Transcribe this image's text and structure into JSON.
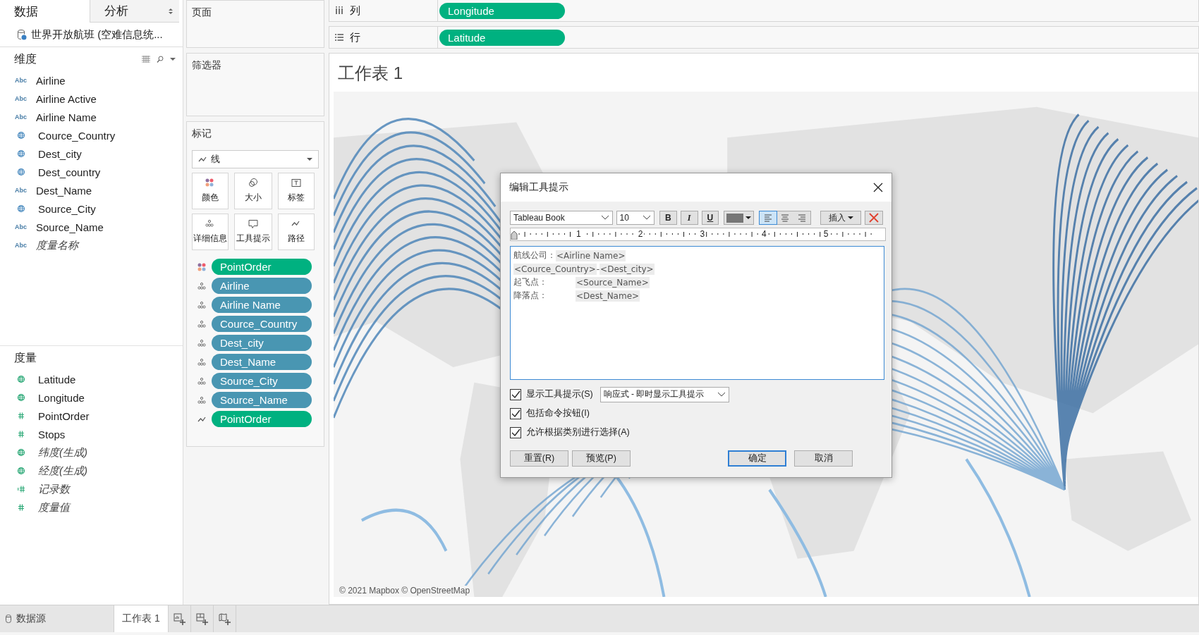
{
  "sidebar": {
    "tabs": [
      {
        "label": "数据",
        "selected": true
      },
      {
        "label": "分析",
        "selected": false
      }
    ],
    "datasource": "世界开放航班 (空难信息统...",
    "dimensions": {
      "title": "维度",
      "fields": [
        {
          "name": "Airline",
          "kind": "string",
          "badge": "Abc",
          "generated": false
        },
        {
          "name": "Airline Active",
          "kind": "string",
          "badge": "Abc",
          "generated": false
        },
        {
          "name": "Airline Name",
          "kind": "string",
          "badge": "Abc",
          "generated": false
        },
        {
          "name": "Cource_Country",
          "kind": "geo",
          "generated": false
        },
        {
          "name": "Dest_city",
          "kind": "geo",
          "generated": false
        },
        {
          "name": "Dest_country",
          "kind": "geo",
          "generated": false
        },
        {
          "name": "Dest_Name",
          "kind": "string",
          "badge": "Abc",
          "generated": false
        },
        {
          "name": "Source_City",
          "kind": "geo",
          "generated": false
        },
        {
          "name": "Source_Name",
          "kind": "string",
          "badge": "Abc",
          "generated": false
        },
        {
          "name": "度量名称",
          "kind": "string",
          "badge": "Abc",
          "generated": true
        }
      ]
    },
    "measures": {
      "title": "度量",
      "fields": [
        {
          "name": "Latitude",
          "kind": "geo",
          "generated": false
        },
        {
          "name": "Longitude",
          "kind": "geo",
          "generated": false
        },
        {
          "name": "PointOrder",
          "kind": "number",
          "generated": false
        },
        {
          "name": "Stops",
          "kind": "number",
          "generated": false
        },
        {
          "name": "纬度(生成)",
          "kind": "geo",
          "generated": true
        },
        {
          "name": "经度(生成)",
          "kind": "geo",
          "generated": true
        },
        {
          "name": "记录数",
          "kind": "count",
          "generated": true
        },
        {
          "name": "度量值",
          "kind": "number",
          "generated": true
        }
      ]
    }
  },
  "pages": {
    "title": "页面"
  },
  "filters": {
    "title": "筛选器"
  },
  "marks": {
    "title": "标记",
    "mark_type": "线",
    "buttons": [
      {
        "label": "颜色",
        "kind": "color"
      },
      {
        "label": "大小",
        "kind": "size"
      },
      {
        "label": "标签",
        "kind": "label"
      },
      {
        "label": "详细信息",
        "kind": "detail"
      },
      {
        "label": "工具提示",
        "kind": "tooltip"
      },
      {
        "label": "路径",
        "kind": "path"
      }
    ],
    "pills": [
      {
        "label": "PointOrder",
        "kind": "color",
        "discrete": false
      },
      {
        "label": "Airline",
        "kind": "detail",
        "discrete": true
      },
      {
        "label": "Airline Name",
        "kind": "detail",
        "discrete": true
      },
      {
        "label": "Cource_Country",
        "kind": "detail",
        "discrete": true
      },
      {
        "label": "Dest_city",
        "kind": "detail",
        "discrete": true
      },
      {
        "label": "Dest_Name",
        "kind": "detail",
        "discrete": true
      },
      {
        "label": "Source_City",
        "kind": "detail",
        "discrete": true
      },
      {
        "label": "Source_Name",
        "kind": "detail",
        "discrete": true
      },
      {
        "label": "PointOrder",
        "kind": "path",
        "discrete": false
      }
    ]
  },
  "shelves": [
    {
      "kind": "columns",
      "label": "列",
      "pill": "Longitude"
    },
    {
      "kind": "rows",
      "label": "行",
      "pill": "Latitude"
    }
  ],
  "sheet": {
    "title": "工作表 1",
    "attribution": "© 2021 Mapbox © OpenStreetMap"
  },
  "dialog": {
    "title": "编辑工具提示",
    "font": "Tableau Book",
    "size": "10",
    "format": [
      {
        "label": "B",
        "kind": "bold"
      },
      {
        "label": "I",
        "kind": "italic"
      },
      {
        "label": "U",
        "kind": "underline"
      }
    ],
    "align": [
      {
        "kind": "left",
        "selected": true
      },
      {
        "kind": "center",
        "selected": false
      },
      {
        "kind": "right",
        "selected": false
      }
    ],
    "insert": "插入",
    "ruler": [
      "1",
      "2",
      "3",
      "4",
      "5"
    ],
    "lines": [
      [
        {
          "kind": "text",
          "text": "航线公司："
        },
        {
          "kind": "field",
          "text": "<Airline Name>"
        }
      ],
      [
        {
          "kind": "field",
          "text": "<Cource_Country>"
        },
        {
          "kind": "text",
          "text": " - "
        },
        {
          "kind": "field",
          "text": "<Dest_city>"
        }
      ],
      [
        {
          "kind": "label",
          "text": "起飞点："
        },
        {
          "kind": "field",
          "text": "<Source_Name>"
        }
      ],
      [
        {
          "kind": "label",
          "text": "降落点："
        },
        {
          "kind": "field",
          "text": "<Dest_Name>"
        }
      ]
    ],
    "options": [
      {
        "label": "显示工具提示(S)",
        "checked": true,
        "dropdown": "响应式 - 即时显示工具提示"
      },
      {
        "label": "包括命令按钮(I)",
        "checked": true
      },
      {
        "label": "允许根据类别进行选择(A)",
        "checked": true
      }
    ],
    "buttons": [
      {
        "label": "重置(R)",
        "default": false
      },
      {
        "label": "预览(P)",
        "default": false
      },
      {
        "label": "确定",
        "default": true
      },
      {
        "label": "取消",
        "default": false
      }
    ]
  },
  "bottom": {
    "datasource": "数据源",
    "tabs": [
      {
        "label": "工作表 1",
        "selected": true
      }
    ],
    "new_buttons": [
      {
        "kind": "worksheet"
      },
      {
        "kind": "dashboard"
      },
      {
        "kind": "story"
      }
    ]
  }
}
